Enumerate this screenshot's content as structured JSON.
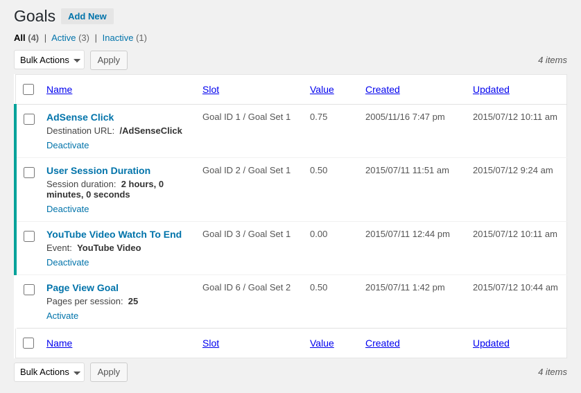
{
  "page_title": "Goals",
  "add_new_label": "Add New",
  "filters": {
    "all": {
      "label": "All",
      "count": "(4)"
    },
    "active": {
      "label": "Active",
      "count": "(3)"
    },
    "inactive": {
      "label": "Inactive",
      "count": "(1)"
    }
  },
  "bulk_actions_label": "Bulk Actions",
  "apply_label": "Apply",
  "items_count": "4 items",
  "columns": {
    "name": "Name",
    "slot": "Slot",
    "value": "Value",
    "created": "Created",
    "updated": "Updated"
  },
  "rows": [
    {
      "active": true,
      "title": "AdSense Click",
      "meta_label": "Destination URL:",
      "meta_value": "/AdSenseClick",
      "action": "Deactivate",
      "slot": "Goal ID 1 / Goal Set 1",
      "value": "0.75",
      "created": "2005/11/16 7:47 pm",
      "updated": "2015/07/12 10:11 am"
    },
    {
      "active": true,
      "title": "User Session Duration",
      "meta_label": "Session duration:",
      "meta_value": "2 hours, 0 minutes, 0 seconds",
      "action": "Deactivate",
      "slot": "Goal ID 2 / Goal Set 1",
      "value": "0.50",
      "created": "2015/07/11 11:51 am",
      "updated": "2015/07/12 9:24 am"
    },
    {
      "active": true,
      "title": "YouTube Video Watch To End",
      "meta_label": "Event:",
      "meta_value": "YouTube Video",
      "action": "Deactivate",
      "slot": "Goal ID 3 / Goal Set 1",
      "value": "0.00",
      "created": "2015/07/11 12:44 pm",
      "updated": "2015/07/12 10:11 am"
    },
    {
      "active": false,
      "title": "Page View Goal",
      "meta_label": "Pages per session:",
      "meta_value": "25",
      "action": "Activate",
      "slot": "Goal ID 6 / Goal Set 2",
      "value": "0.50",
      "created": "2015/07/11 1:42 pm",
      "updated": "2015/07/12 10:44 am"
    }
  ]
}
